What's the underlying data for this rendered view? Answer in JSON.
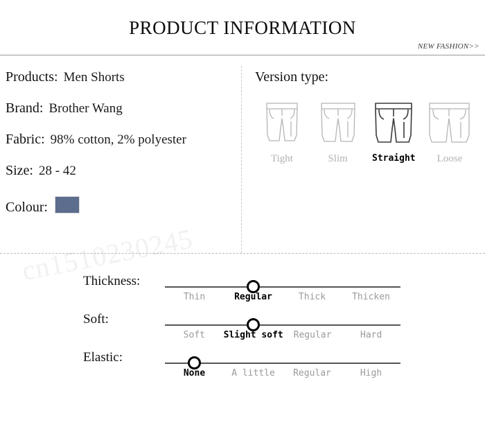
{
  "header": {
    "title": "PRODUCT INFORMATION",
    "tagline": "NEW FASHION>>"
  },
  "watermark": {
    "text": "cn1510230245"
  },
  "specs": {
    "items": [
      {
        "label": "Products:",
        "value": "Men Shorts"
      },
      {
        "label": "Brand:",
        "value": "Brother Wang"
      },
      {
        "label": "Fabric:",
        "value": "98% cotton, 2% polyester"
      },
      {
        "label": "Size:",
        "value": "28 - 42"
      },
      {
        "label": "Colour:",
        "value": ""
      }
    ],
    "colour_swatch_hex": "#5c6d8e"
  },
  "version_type": {
    "title": "Version type:",
    "options": [
      {
        "label": "Tight",
        "selected": false
      },
      {
        "label": "Slim",
        "selected": false
      },
      {
        "label": "Straight",
        "selected": true
      },
      {
        "label": "Loose",
        "selected": false
      }
    ],
    "icon_name": "shorts-icon",
    "icon_color_unselected": "#b5b5b5",
    "icon_color_selected": "#3a3a3a"
  },
  "sliders": [
    {
      "name": "Thickness:",
      "ticks": [
        "Thin",
        "Regular",
        "Thick",
        "Thicken"
      ],
      "selected_index": 1
    },
    {
      "name": "Soft:",
      "ticks": [
        "Soft",
        "Slight soft",
        "Regular",
        "Hard"
      ],
      "selected_index": 1
    },
    {
      "name": "Elastic:",
      "ticks": [
        "None",
        "A little",
        "Regular",
        "High"
      ],
      "selected_index": 0
    }
  ]
}
